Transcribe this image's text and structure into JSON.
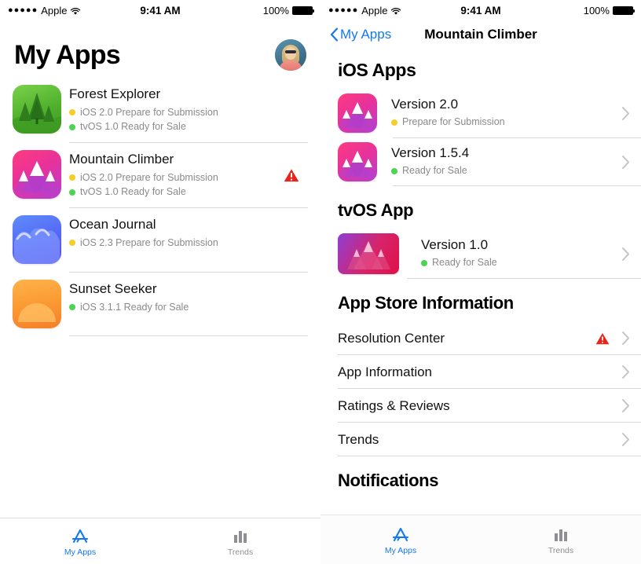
{
  "status_bar": {
    "signal_dots": "●●●●●",
    "carrier": "Apple",
    "wifi_icon": "wifi-icon",
    "time": "9:41 AM",
    "battery_percent": "100%",
    "battery_icon": "battery-full-icon"
  },
  "colors": {
    "accent_blue": "#1478f0",
    "status_yellow": "#f4cf2a",
    "status_green": "#4cd452",
    "warning_red": "#e8251b",
    "separator": "#d8d8d8",
    "secondary_text": "#8a8a8e"
  },
  "left_screen": {
    "title": "My Apps",
    "avatar": {
      "name": "account-avatar",
      "icon": "user-photo-avatar"
    },
    "apps": [
      {
        "name": "Forest Explorer",
        "icon": "forest-explorer-app-icon",
        "has_warning": false,
        "statuses": [
          {
            "dot": "yellow",
            "text": "iOS 2.0 Prepare for Submission"
          },
          {
            "dot": "green",
            "text": "tvOS 1.0 Ready for Sale"
          }
        ]
      },
      {
        "name": "Mountain Climber",
        "icon": "mountain-climber-app-icon",
        "has_warning": true,
        "warning_icon": "warning-triangle-icon",
        "statuses": [
          {
            "dot": "yellow",
            "text": "iOS 2.0 Prepare for Submission"
          },
          {
            "dot": "green",
            "text": "tvOS 1.0 Ready for Sale"
          }
        ]
      },
      {
        "name": "Ocean Journal",
        "icon": "ocean-journal-app-icon",
        "has_warning": false,
        "statuses": [
          {
            "dot": "yellow",
            "text": "iOS 2.3 Prepare for Submission"
          }
        ]
      },
      {
        "name": "Sunset Seeker",
        "icon": "sunset-seeker-app-icon",
        "has_warning": false,
        "statuses": [
          {
            "dot": "green",
            "text": "iOS 3.1.1 Ready for Sale"
          }
        ]
      }
    ],
    "tabs": [
      {
        "label": "My Apps",
        "icon": "app-store-icon",
        "active": true
      },
      {
        "label": "Trends",
        "icon": "bar-chart-icon",
        "active": false
      }
    ]
  },
  "right_screen": {
    "back_label": "My Apps",
    "back_icon": "chevron-left-icon",
    "nav_title": "Mountain Climber",
    "sections": [
      {
        "heading": "iOS Apps",
        "versions": [
          {
            "title": "Version 2.0",
            "icon": "mountain-climber-app-icon",
            "dot": "yellow",
            "status": "Prepare for Submission",
            "chevron": "chevron-right-icon"
          },
          {
            "title": "Version 1.5.4",
            "icon": "mountain-climber-app-icon",
            "dot": "green",
            "status": "Ready for Sale",
            "chevron": "chevron-right-icon"
          }
        ]
      },
      {
        "heading": "tvOS App",
        "versions": [
          {
            "title": "Version 1.0",
            "icon": "mountain-climber-tvos-icon",
            "dot": "green",
            "status": "Ready for Sale",
            "chevron": "chevron-right-icon"
          }
        ]
      }
    ],
    "info_heading": "App Store Information",
    "info_links": [
      {
        "label": "Resolution Center",
        "has_warning": true,
        "warning_icon": "warning-triangle-icon",
        "chevron": "chevron-right-icon"
      },
      {
        "label": "App Information",
        "has_warning": false,
        "chevron": "chevron-right-icon"
      },
      {
        "label": "Ratings & Reviews",
        "has_warning": false,
        "chevron": "chevron-right-icon"
      },
      {
        "label": "Trends",
        "has_warning": false,
        "chevron": "chevron-right-icon"
      }
    ],
    "notifications_heading": "Notifications",
    "tabs": [
      {
        "label": "My Apps",
        "icon": "app-store-icon",
        "active": true
      },
      {
        "label": "Trends",
        "icon": "bar-chart-icon",
        "active": false
      }
    ]
  }
}
